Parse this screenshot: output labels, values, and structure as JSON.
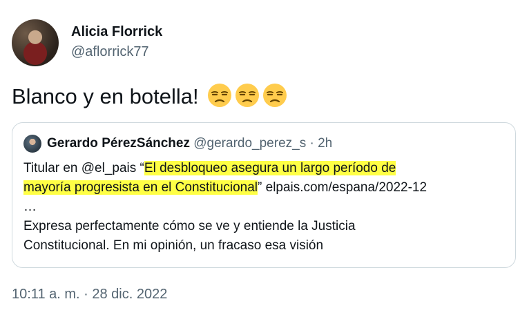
{
  "author": {
    "name": "Alicia Florrick",
    "handle": "@aflorrick77"
  },
  "tweet": {
    "text": "Blanco y en botella!",
    "emojis": [
      "unamused-face-icon",
      "unamused-face-icon",
      "unamused-face-icon"
    ]
  },
  "quote": {
    "author_name": "Gerardo PérezSánchez",
    "author_handle": "@gerardo_perez_s",
    "separator": "·",
    "time": "2h",
    "line1_prefix": "Titular en @el_pais “",
    "line1_highlight": "El desbloqueo asegura un largo período de",
    "line2_highlight": "mayoría progresista en el Constitucional",
    "line2_suffix": "” elpais.com/espana/2022-12",
    "line3": "…",
    "line4": "Expresa perfectamente cómo se ve y entiende la Justicia",
    "line5": "Constitucional. En mi opinión, un fracaso esa visión"
  },
  "timestamp": "10:11 a. m. · 28 dic. 2022",
  "colors": {
    "highlight": "#ffff45",
    "secondary_text": "#536471",
    "border": "#cfd9de",
    "emoji_face": "#ffcc4d"
  }
}
